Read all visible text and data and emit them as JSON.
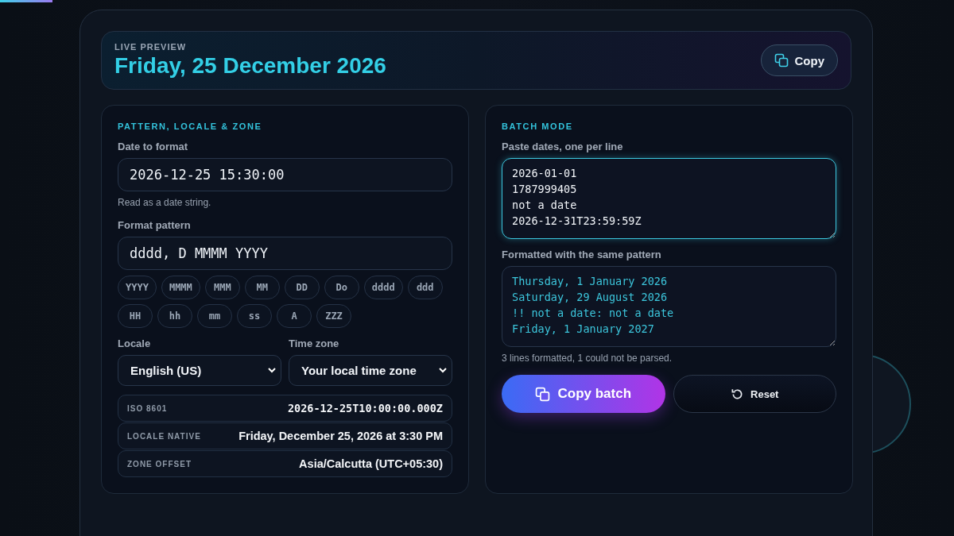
{
  "preview": {
    "label": "LIVE PREVIEW",
    "value": "Friday, 25 December 2026",
    "copy_button": "Copy"
  },
  "settings": {
    "heading": "PATTERN, LOCALE & ZONE",
    "date_field": {
      "label": "Date to format",
      "value": "2026-12-25 15:30:00",
      "hint": "Read as a date string."
    },
    "pattern_field": {
      "label": "Format pattern",
      "value": "dddd, D MMMM YYYY"
    },
    "tokens": [
      [
        "YYYY",
        "MMMM",
        "MMM",
        "MM",
        "DD",
        "Do",
        "dddd",
        "ddd"
      ],
      [
        "HH",
        "hh",
        "mm",
        "ss",
        "A",
        "ZZZ"
      ]
    ],
    "locale": {
      "label": "Locale",
      "value": "English (US)"
    },
    "time_zone": {
      "label": "Time zone",
      "value": "Your local time zone"
    },
    "results": [
      {
        "label": "ISO 8601",
        "value": "2026-12-25T10:00:00.000Z",
        "kind": "mono"
      },
      {
        "label": "LOCALE NATIVE",
        "value": "Friday, December 25, 2026 at 3:30 PM",
        "kind": "text"
      },
      {
        "label": "ZONE OFFSET",
        "value": "Asia/Calcutta (UTC+05:30)",
        "kind": "text"
      }
    ]
  },
  "batch": {
    "heading": "BATCH MODE",
    "input": {
      "label": "Paste dates, one per line",
      "focused": true,
      "lines": [
        "2026-01-01",
        "1787999405",
        "not a date",
        "2026-12-31T23:59:59Z"
      ]
    },
    "output": {
      "label": "Formatted with the same pattern",
      "lines": [
        "Thursday, 1 January 2026",
        "Saturday, 29 August 2026",
        "!! not a date: not a date",
        "Friday, 1 January 2027"
      ]
    },
    "summary": "3 lines formatted, 1 could not be parsed.",
    "copy_button": "Copy batch",
    "reset_button": "Reset"
  }
}
